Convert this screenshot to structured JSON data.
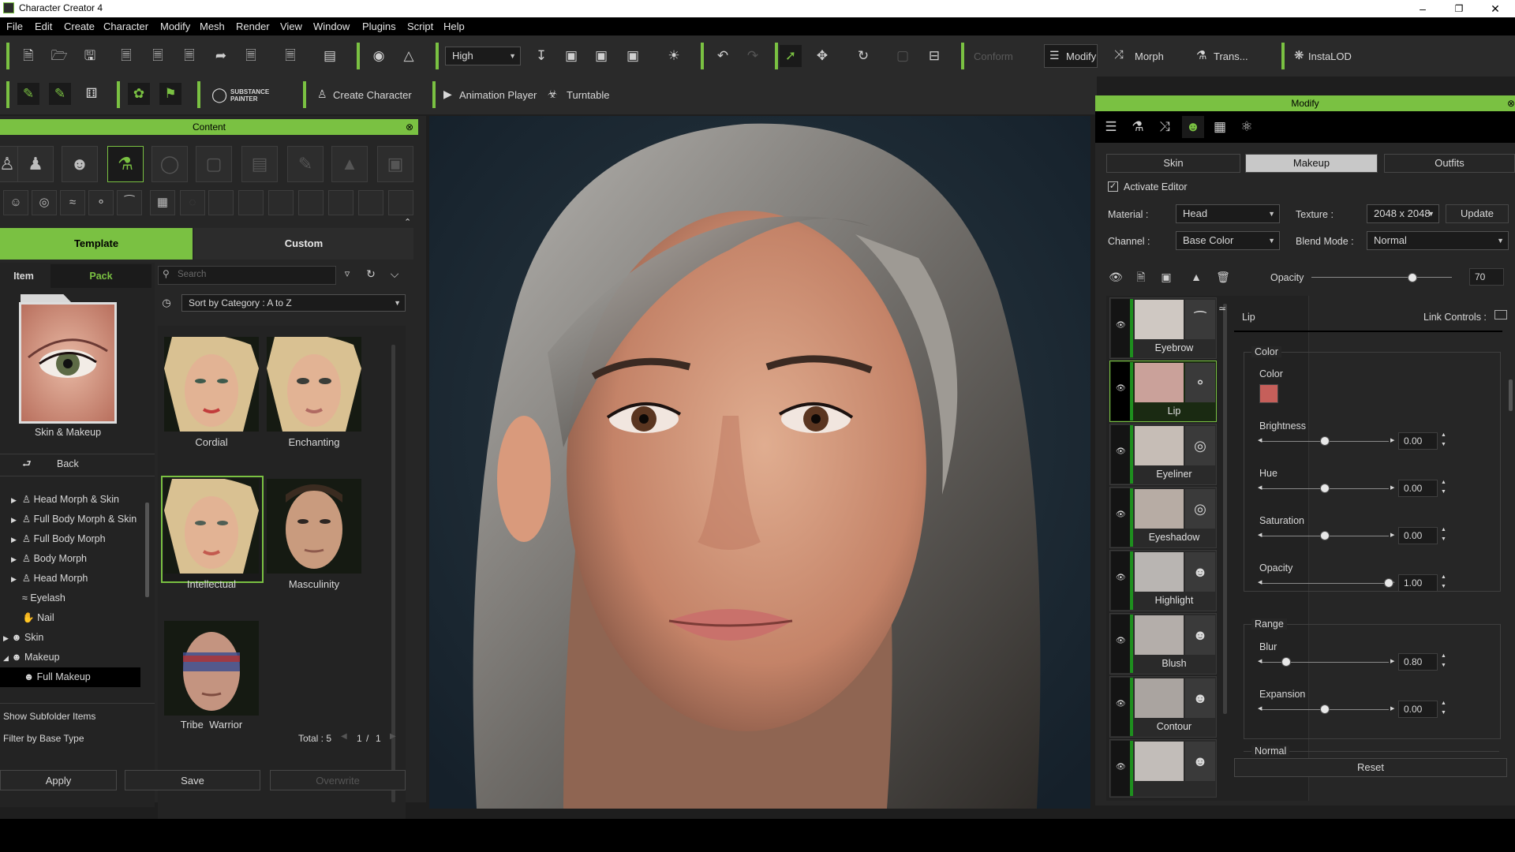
{
  "window": {
    "title": "Character Creator 4"
  },
  "menu": [
    "File",
    "Edit",
    "Create",
    "Character",
    "Modify",
    "Mesh",
    "Render",
    "View",
    "Window",
    "Plugins",
    "Script",
    "Help"
  ],
  "toolbar": {
    "quality": "High",
    "conform_label": "Conform",
    "modify_label": "Modify",
    "morph_label": "Morph",
    "trans_label": "Trans...",
    "instalod_label": "InstaLOD",
    "substance_label": "SUBSTANCE PAINTER",
    "create_character_label": "Create Character",
    "animation_player_label": "Animation Player",
    "turntable_label": "Turntable"
  },
  "content": {
    "header": "Content",
    "tabs": {
      "template": "Template",
      "custom": "Custom"
    },
    "subtabs": {
      "item": "Item",
      "pack": "Pack"
    },
    "pack_title": "Skin & Makeup",
    "back_label": "Back",
    "search_placeholder": "Search",
    "sort_label": "Sort by Category : A to Z",
    "tree": [
      {
        "label": "Head Morph & Skin"
      },
      {
        "label": "Full Body Morph & Skin"
      },
      {
        "label": "Full Body Morph"
      },
      {
        "label": "Body Morph"
      },
      {
        "label": "Head Morph"
      },
      {
        "label": "Eyelash"
      },
      {
        "label": "Nail"
      },
      {
        "label": "Skin"
      },
      {
        "label": "Makeup"
      },
      {
        "label": "Full Makeup"
      }
    ],
    "items": [
      {
        "label": "Cordial"
      },
      {
        "label": "Enchanting"
      },
      {
        "label": "Intellectual"
      },
      {
        "label": "Masculinity"
      },
      {
        "label": "Tribe_Warrior"
      }
    ],
    "show_subfolder": "Show Subfolder Items",
    "filter_base": "Filter by Base Type",
    "total": "Total : 5",
    "page_current": "1",
    "page_sep": "/",
    "page_total": "1",
    "buttons": {
      "apply": "Apply",
      "save": "Save",
      "overwrite": "Overwrite"
    }
  },
  "modify": {
    "header": "Modify",
    "tabs": {
      "skin": "Skin",
      "makeup": "Makeup",
      "outfits": "Outfits"
    },
    "activate_editor": "Activate Editor",
    "material_label": "Material :",
    "material_value": "Head",
    "texture_label": "Texture :",
    "texture_value": "2048 x 2048",
    "update_label": "Update",
    "channel_label": "Channel :",
    "channel_value": "Base Color",
    "blend_label": "Blend Mode :",
    "blend_value": "Normal",
    "opacity_label": "Opacity",
    "opacity_value": "70",
    "opacity_level": 0.72,
    "layers": [
      {
        "label": "Eyebrow"
      },
      {
        "label": "Lip"
      },
      {
        "label": "Eyeliner"
      },
      {
        "label": "Eyeshadow"
      },
      {
        "label": "Highlight"
      },
      {
        "label": "Blush"
      },
      {
        "label": "Contour"
      }
    ],
    "selected_layer": "Lip",
    "link_controls": "Link Controls :",
    "color_group": "Color",
    "color_label": "Color",
    "color_swatch": "#c65f5a",
    "sliders": [
      {
        "label": "Brightness",
        "value": "0.00",
        "level": 0.5
      },
      {
        "label": "Hue",
        "value": "0.00",
        "level": 0.5
      },
      {
        "label": "Saturation",
        "value": "0.00",
        "level": 0.5
      },
      {
        "label": "Opacity",
        "value": "1.00",
        "level": 1.0
      }
    ],
    "range_group": "Range",
    "range_sliders": [
      {
        "label": "Blur",
        "value": "0.80",
        "level": 0.2
      },
      {
        "label": "Expansion",
        "value": "0.00",
        "level": 0.5
      }
    ],
    "normal_group": "Normal",
    "reset_label": "Reset"
  },
  "colors": {
    "accent": "#7ac142",
    "panel": "#262626",
    "bar": "#000000"
  }
}
